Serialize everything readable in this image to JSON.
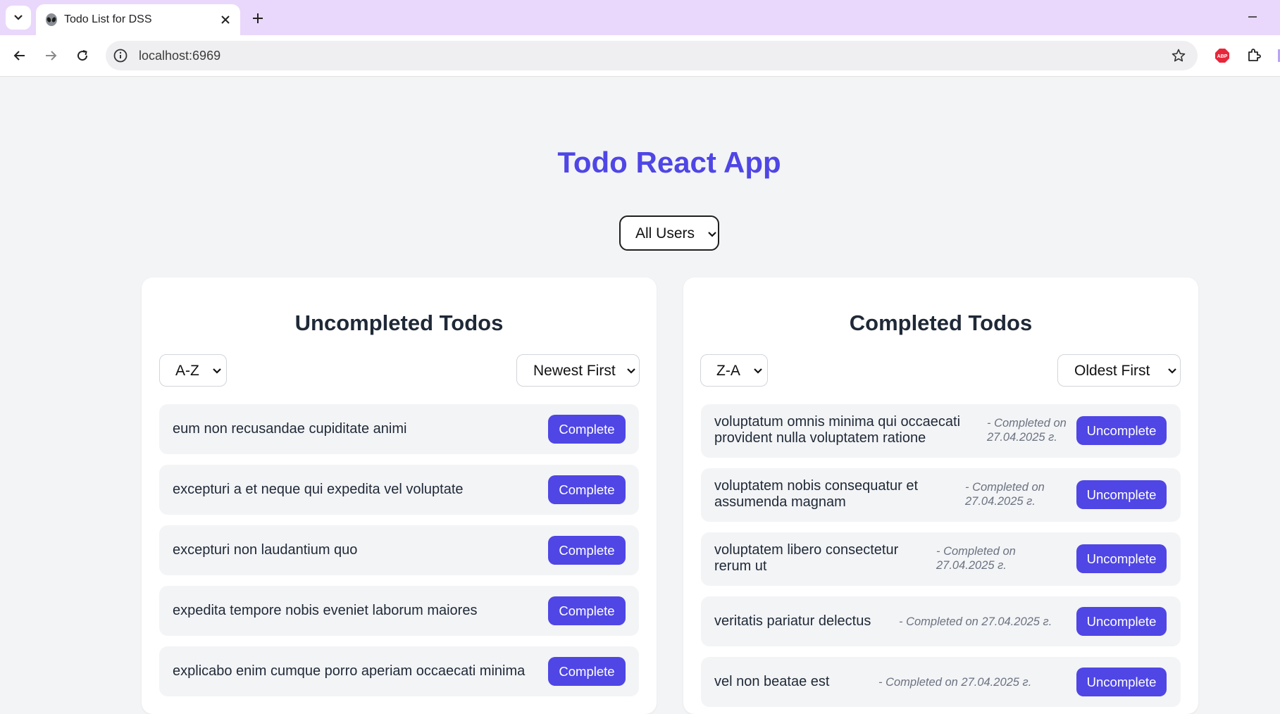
{
  "browser": {
    "tab_title": "Todo List for DSS",
    "url": "localhost:6969"
  },
  "app": {
    "title": "Todo React App",
    "user_filter": "All Users"
  },
  "uncompleted": {
    "title": "Uncompleted Todos",
    "sort_alpha": "A-Z",
    "sort_date": "Newest First",
    "button_label": "Complete",
    "items": [
      {
        "text": "eum non recusandae cupiditate animi"
      },
      {
        "text": "excepturi a et neque qui expedita vel voluptate"
      },
      {
        "text": "excepturi non laudantium quo"
      },
      {
        "text": "expedita tempore nobis eveniet laborum maiores"
      },
      {
        "text": "explicabo enim cumque porro aperiam occaecati minima"
      }
    ]
  },
  "completed": {
    "title": "Completed Todos",
    "sort_alpha": "Z-A",
    "sort_date": "Oldest First",
    "button_label": "Uncomplete",
    "items": [
      {
        "text_line1": "voluptatum omnis minima qui occaecati",
        "text_line2": "provident nulla voluptatem ratione",
        "date_line1": "- Completed on",
        "date_line2": "27.04.2025 г."
      },
      {
        "text_line1": "voluptatem nobis consequatur et",
        "text_line2": "assumenda magnam",
        "date_line1": "- Completed on",
        "date_line2": "27.04.2025 г."
      },
      {
        "text_line1": "voluptatem libero consectetur",
        "text_line2": "rerum ut",
        "date_line1": "- Completed on",
        "date_line2": "27.04.2025 г."
      },
      {
        "text": "veritatis pariatur delectus",
        "date": "- Completed on 27.04.2025 г."
      },
      {
        "text": "vel non beatae est",
        "date": "- Completed on 27.04.2025 г."
      }
    ]
  },
  "colors": {
    "accent": "#4f46e5",
    "background": "#f3f4f6",
    "tabbar": "#e9d8fb"
  }
}
